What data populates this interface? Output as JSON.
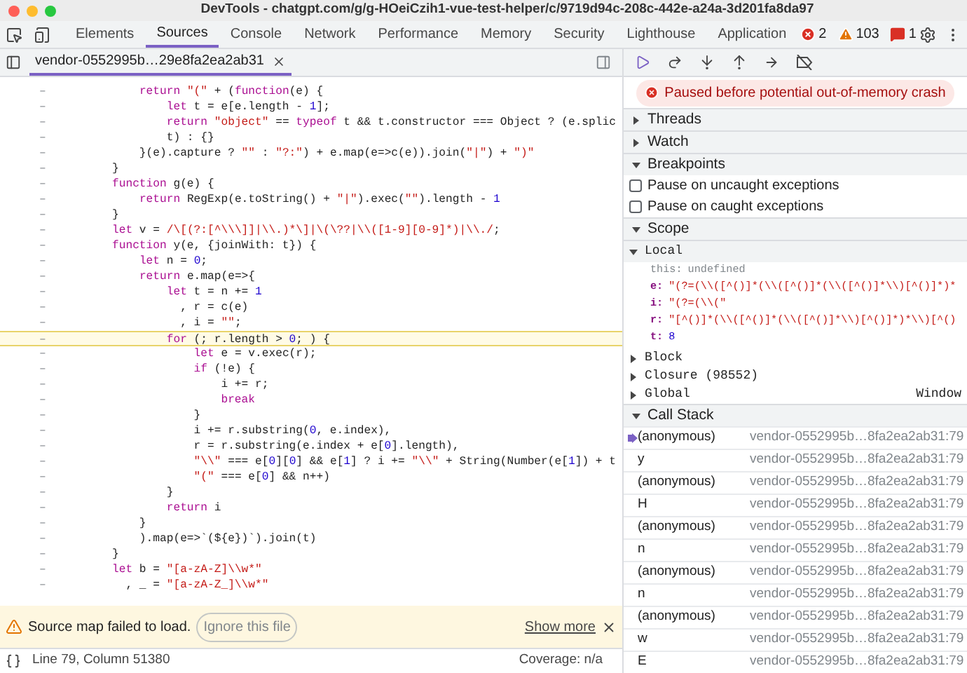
{
  "window": {
    "title": "DevTools - chatgpt.com/g/g-HOeiCzih1-vue-test-helper/c/9719d94c-208c-442e-a24a-3d201fa8da97"
  },
  "panel_tabs": [
    {
      "label": "Elements",
      "selected": false
    },
    {
      "label": "Sources",
      "selected": true
    },
    {
      "label": "Console",
      "selected": false
    },
    {
      "label": "Network",
      "selected": false
    },
    {
      "label": "Performance",
      "selected": false
    },
    {
      "label": "Memory",
      "selected": false
    },
    {
      "label": "Security",
      "selected": false
    },
    {
      "label": "Lighthouse",
      "selected": false
    },
    {
      "label": "Application",
      "selected": false
    }
  ],
  "issue_counts": [
    {
      "kind": "error",
      "count": "2"
    },
    {
      "kind": "warning",
      "count": "103"
    },
    {
      "kind": "issue",
      "count": "1"
    }
  ],
  "file_tabs": [
    {
      "label": "vendor-0552995b…29e8fa2ea2ab31",
      "selected": true
    }
  ],
  "code": {
    "lines": [
      {
        "gutter": "–",
        "text": "    return \"(\" + (function(e) {",
        "current": false
      },
      {
        "gutter": "–",
        "text": "        let t = e[e.length - 1];",
        "current": false
      },
      {
        "gutter": "–",
        "text": "        return \"object\" == typeof t && t.constructor === Object ? (e.splic",
        "current": false
      },
      {
        "gutter": "–",
        "text": "        t) : {}",
        "current": false
      },
      {
        "gutter": "–",
        "text": "    }(e).capture ? \"\" : \"?:\") + e.map(e=>c(e)).join(\"|\") + \")\"",
        "current": false
      },
      {
        "gutter": "–",
        "text": "}",
        "current": false
      },
      {
        "gutter": "–",
        "text": "function g(e) {",
        "current": false
      },
      {
        "gutter": "–",
        "text": "    return RegExp(e.toString() + \"|\").exec(\"\").length - 1",
        "current": false
      },
      {
        "gutter": "–",
        "text": "}",
        "current": false
      },
      {
        "gutter": "–",
        "text": "let v = /\\[(?:[^\\\\\\]]|\\\\.)*\\]|\\(\\??|\\\\([1-9][0-9]*)|\\\\./;",
        "current": false
      },
      {
        "gutter": "–",
        "text": "function y(e, {joinWith: t}) {",
        "current": false
      },
      {
        "gutter": "–",
        "text": "    let n = 0;",
        "current": false
      },
      {
        "gutter": "–",
        "text": "    return e.map(e=>{",
        "current": false
      },
      {
        "gutter": "–",
        "text": "        let t = n += 1",
        "current": false
      },
      {
        "gutter": "–",
        "text": "          , r = c(e)",
        "current": false
      },
      {
        "gutter": "–",
        "text": "          , i = \"\";",
        "current": false
      },
      {
        "gutter": "–",
        "text": "        for (; r.length > 0; ) {",
        "current": true
      },
      {
        "gutter": "–",
        "text": "            let e = v.exec(r);",
        "current": false
      },
      {
        "gutter": "–",
        "text": "            if (!e) {",
        "current": false
      },
      {
        "gutter": "–",
        "text": "                i += r;",
        "current": false
      },
      {
        "gutter": "–",
        "text": "                break",
        "current": false
      },
      {
        "gutter": "–",
        "text": "            }",
        "current": false
      },
      {
        "gutter": "–",
        "text": "            i += r.substring(0, e.index),",
        "current": false
      },
      {
        "gutter": "–",
        "text": "            r = r.substring(e.index + e[0].length),",
        "current": false
      },
      {
        "gutter": "–",
        "text": "            \"\\\\\" === e[0][0] && e[1] ? i += \"\\\\\" + String(Number(e[1]) + t",
        "current": false
      },
      {
        "gutter": "–",
        "text": "            \"(\" === e[0] && n++)",
        "current": false
      },
      {
        "gutter": "–",
        "text": "        }",
        "current": false
      },
      {
        "gutter": "–",
        "text": "        return i",
        "current": false
      },
      {
        "gutter": "–",
        "text": "    }",
        "current": false
      },
      {
        "gutter": "–",
        "text": "    ).map(e=>`(${e})`).join(t)",
        "current": false
      },
      {
        "gutter": "–",
        "text": "}",
        "current": false
      },
      {
        "gutter": "–",
        "text": "let b = \"[a-zA-Z]\\\\w*\"",
        "current": false
      },
      {
        "gutter": "–",
        "text": "  , _ = \"[a-zA-Z_]\\\\w*\"",
        "current": false
      }
    ]
  },
  "warning": {
    "message": "Source map failed to load.",
    "ignore_button": "Ignore this file",
    "show_more": "Show more"
  },
  "status_bar": {
    "position": "Line 79, Column 51380",
    "coverage": "Coverage: n/a"
  },
  "debugger": {
    "paused_message": "Paused before potential out-of-memory crash",
    "threads": {
      "title": "Threads",
      "expanded": false
    },
    "watch": {
      "title": "Watch",
      "expanded": false
    },
    "breakpoints": {
      "title": "Breakpoints",
      "expanded": true,
      "options": [
        {
          "label": "Pause on uncaught exceptions",
          "checked": false
        },
        {
          "label": "Pause on caught exceptions",
          "checked": false
        }
      ]
    },
    "scope": {
      "title": "Scope",
      "expanded": true,
      "children": [
        {
          "label": "Local",
          "expanded": true,
          "variables": [
            {
              "name": "this:",
              "value": "undefined",
              "kind": "undefined"
            },
            {
              "name": "e:",
              "value": "\"(?=(\\\\([^()]*(\\\\([^()]*(\\\\([^()]*\\\\)[^()]*)*",
              "kind": "string"
            },
            {
              "name": "i:",
              "value": "\"(?=(\\\\(\"",
              "kind": "string"
            },
            {
              "name": "r:",
              "value": "\"[^()]*(\\\\([^()]*(\\\\([^()]*\\\\)[^()]*)*\\\\)[^()",
              "kind": "string"
            },
            {
              "name": "t:",
              "value": "8",
              "kind": "number"
            }
          ]
        },
        {
          "label": "Block",
          "expanded": false
        },
        {
          "label": "Closure (98552)",
          "expanded": false
        },
        {
          "label": "Global",
          "expanded": false,
          "value": "Window"
        }
      ]
    },
    "call_stack": {
      "title": "Call Stack",
      "expanded": true,
      "frames": [
        {
          "name": "(anonymous)",
          "location": "vendor-0552995b…8fa2ea2ab31:79",
          "current": true
        },
        {
          "name": "y",
          "location": "vendor-0552995b…8fa2ea2ab31:79",
          "current": false
        },
        {
          "name": "(anonymous)",
          "location": "vendor-0552995b…8fa2ea2ab31:79",
          "current": false
        },
        {
          "name": "H",
          "location": "vendor-0552995b…8fa2ea2ab31:79",
          "current": false
        },
        {
          "name": "(anonymous)",
          "location": "vendor-0552995b…8fa2ea2ab31:79",
          "current": false
        },
        {
          "name": "n",
          "location": "vendor-0552995b…8fa2ea2ab31:79",
          "current": false
        },
        {
          "name": "(anonymous)",
          "location": "vendor-0552995b…8fa2ea2ab31:79",
          "current": false
        },
        {
          "name": "n",
          "location": "vendor-0552995b…8fa2ea2ab31:79",
          "current": false
        },
        {
          "name": "(anonymous)",
          "location": "vendor-0552995b…8fa2ea2ab31:79",
          "current": false
        },
        {
          "name": "w",
          "location": "vendor-0552995b…8fa2ea2ab31:79",
          "current": false
        },
        {
          "name": "E",
          "location": "vendor-0552995b…8fa2ea2ab31:79",
          "current": false
        }
      ]
    }
  }
}
